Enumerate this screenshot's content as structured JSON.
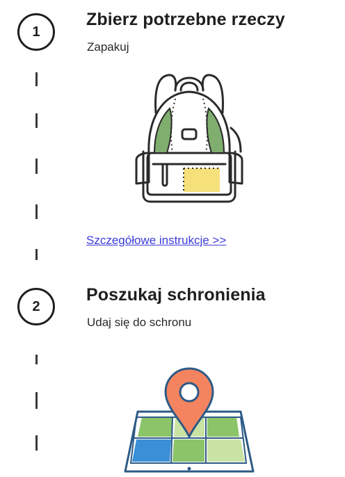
{
  "steps": [
    {
      "number": "1",
      "title": "Zbierz potrzebne rzeczy",
      "subtitle": "Zapakuj",
      "illustration": "backpack-icon",
      "link_label": "Szczegółowe instrukcje >>"
    },
    {
      "number": "2",
      "title": "Poszukaj schronienia",
      "subtitle": "Udaj się do schronu",
      "illustration": "map-pin-icon"
    }
  ],
  "colors": {
    "text": "#1f1f1f",
    "link": "#3b3bdb",
    "backpack_green": "#7fae6f",
    "backpack_yellow": "#f5e07a",
    "pin_orange": "#f4845f",
    "map_blue": "#3a8fd6",
    "map_green": "#8cc46a",
    "map_light_green": "#c9e3a5"
  }
}
